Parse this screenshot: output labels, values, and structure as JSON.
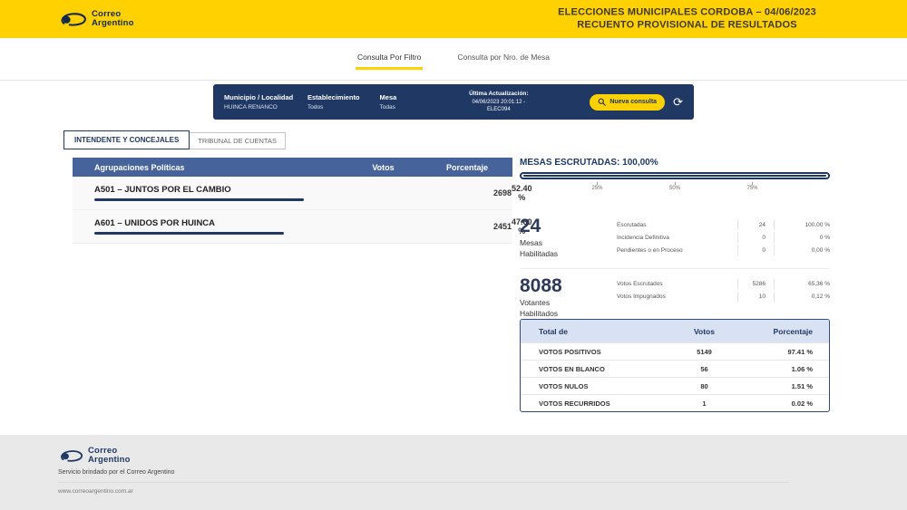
{
  "brand": {
    "line1": "Correo",
    "line2": "Argentino"
  },
  "header": {
    "title1": "ELECCIONES MUNICIPALES CORDOBA – 04/06/2023",
    "title2": "RECUENTO PROVISIONAL DE RESULTADOS"
  },
  "nav": {
    "tab_filter": "Consulta Por Filtro",
    "tab_mesa": "Consulta por Nro. de Mesa"
  },
  "filters": {
    "municipio_label": "Municipio / Localidad",
    "municipio_value": "HUINCA RENANCO",
    "establecimiento_label": "Establecimiento",
    "establecimiento_value": "Todos",
    "mesa_label": "Mesa",
    "mesa_value": "Todas",
    "update_label": "Última Actualización:",
    "update_value": "04/06/2023 20:01:12 -",
    "update_code": "ELEC094",
    "new_query": "Nueva consulta"
  },
  "tabs": {
    "tab1": "INTENDENTE Y CONCEJALES",
    "tab2": "TRIBUNAL DE CUENTAS"
  },
  "results": {
    "col_party": "Agrupaciones Políticas",
    "col_votes": "Votos",
    "col_pct": "Porcentaje",
    "rows": [
      {
        "party": "A501 – JUNTOS POR EL CAMBIO",
        "votes": "2698",
        "pct": "52.40 %",
        "bar": 52.4
      },
      {
        "party": "A601 – UNIDOS POR HUINCA",
        "votes": "2451",
        "pct": "47.60 %",
        "bar": 47.6
      }
    ]
  },
  "scrutiny": {
    "title": "MESAS ESCRUTADAS: 100,00%",
    "progress": 100,
    "tick1": "25%",
    "tick2": "50%",
    "tick3": "75%",
    "mesas_value": "24",
    "mesas_label1": "Mesas",
    "mesas_label2": "Habilitadas",
    "mesas_rows": [
      {
        "label": "Escrutadas",
        "value": "24",
        "pct": "100,00 %"
      },
      {
        "label": "Incidencia Definitiva",
        "value": "0",
        "pct": "0 %"
      },
      {
        "label": "Pendientes o en Proceso",
        "value": "0",
        "pct": "0,00 %"
      }
    ],
    "votantes_value": "8088",
    "votantes_label1": "Votantes",
    "votantes_label2": "Habilitados",
    "votantes_rows": [
      {
        "label": "Votos Escrutados",
        "value": "5286",
        "pct": "65,36 %"
      },
      {
        "label": "Votos Impugnados",
        "value": "10",
        "pct": "0,12 %"
      }
    ]
  },
  "totals": {
    "col1": "Total de",
    "col2": "Votos",
    "col3": "Porcentaje",
    "rows": [
      {
        "label": "VOTOS POSITIVOS",
        "votes": "5149",
        "pct": "97.41 %"
      },
      {
        "label": "VOTOS EN BLANCO",
        "votes": "56",
        "pct": "1.06 %"
      },
      {
        "label": "VOTOS NULOS",
        "votes": "80",
        "pct": "1.51 %"
      },
      {
        "label": "VOTOS RECURRIDOS",
        "votes": "1",
        "pct": "0.02 %"
      }
    ]
  },
  "footer": {
    "service": "Servicio brindado por el Correo Argentino",
    "url": "www.correoargentino.com.ar"
  },
  "colors": {
    "brand_yellow": "#FFD100",
    "navy": "#1F3864",
    "table_header_blue": "#46639C",
    "totals_header_bg": "#D9E2F3"
  }
}
